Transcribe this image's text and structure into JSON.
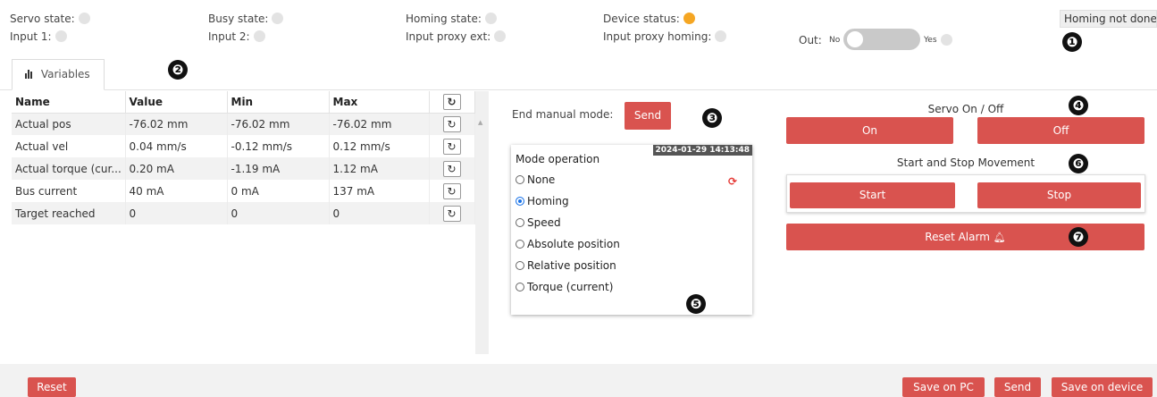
{
  "status": {
    "servo_state": "Servo state:",
    "busy_state": "Busy state:",
    "homing_state": "Homing state:",
    "device_status": "Device status:",
    "input1": "Input 1:",
    "input2": "Input 2:",
    "input_proxy_ext": "Input proxy ext:",
    "input_proxy_homing": "Input proxy homing:",
    "out_label": "Out:",
    "out_no": "No",
    "out_yes": "Yes",
    "homing_not_done": "Homing not done",
    "device_status_color": "#f5a623",
    "led_off_color": "#e3e3e3"
  },
  "badges": [
    "❶",
    "❷",
    "❸",
    "❹",
    "❺",
    "❻",
    "❼"
  ],
  "tab": {
    "label": "Variables",
    "icon": "bar-chart-icon"
  },
  "table": {
    "headers": [
      "Name",
      "Value",
      "Min",
      "Max"
    ],
    "refresh_icon": "↻",
    "rows": [
      [
        "Actual pos",
        "-76.02 mm",
        "-76.02 mm",
        "-76.02 mm"
      ],
      [
        "Actual vel",
        "0.04 mm/s",
        "-0.12 mm/s",
        "0.12 mm/s"
      ],
      [
        "Actual torque (cur...",
        "0.20 mA",
        "-1.19 mA",
        "1.12 mA"
      ],
      [
        "Bus current",
        "40 mA",
        "0 mA",
        "137 mA"
      ],
      [
        "Target reached",
        "0",
        "0",
        "0"
      ]
    ]
  },
  "manual": {
    "label": "End manual mode:",
    "send": "Send"
  },
  "mode": {
    "timestamp": "2024-01-29 14:13:48",
    "title": "Mode operation",
    "options": [
      "None",
      "Homing",
      "Speed",
      "Absolute position",
      "Relative position",
      "Torque (current)"
    ],
    "selected": "Homing",
    "sync_icon": "⟳"
  },
  "servo": {
    "title": "Servo On / Off",
    "on": "On",
    "off": "Off"
  },
  "movement": {
    "title": "Start and Stop Movement",
    "start": "Start",
    "stop": "Stop"
  },
  "alarm": {
    "label": "Reset Alarm",
    "icon": "🔔"
  },
  "footer": {
    "reset": "Reset",
    "save_pc": "Save on PC",
    "send": "Send",
    "save_device": "Save on device"
  },
  "accent_color": "#d9534f"
}
